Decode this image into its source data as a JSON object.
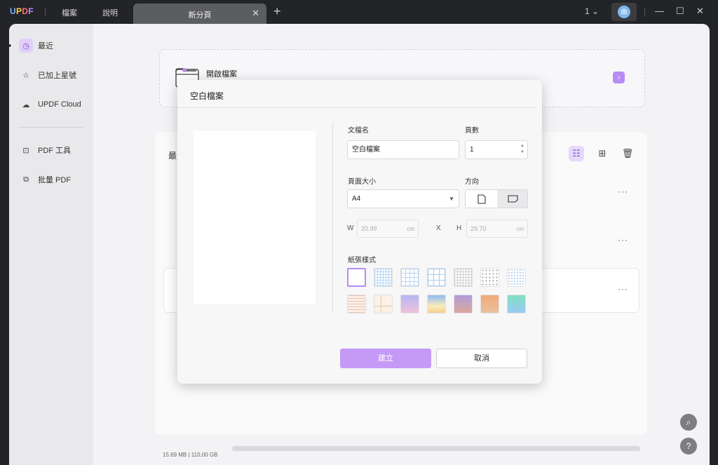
{
  "titlebar": {
    "logo": "UPDF",
    "menu": [
      "檔案",
      "說明"
    ],
    "tab_label": "新分頁",
    "account_number": "1",
    "avatar_initial": "曲"
  },
  "sidebar": {
    "items": [
      {
        "label": "最近",
        "icon": "clock-icon"
      },
      {
        "label": "已加上星號",
        "icon": "star-icon"
      },
      {
        "label": "UPDF Cloud",
        "icon": "cloud-icon"
      },
      {
        "label": "PDF 工具",
        "icon": "toolbox-icon"
      },
      {
        "label": "批量 PDF",
        "icon": "batch-icon"
      }
    ]
  },
  "main": {
    "open_file_label": "開啟檔案",
    "recent_label": "最",
    "storage_text": "15.69 MB | 110.00 GB",
    "storage_used_fraction": 0.0001
  },
  "dialog": {
    "title": "空白檔案",
    "doc_name_label": "文檔名",
    "doc_name_value": "空白檔案",
    "pages_label": "頁數",
    "pages_value": "1",
    "page_size_label": "頁面大小",
    "page_size_value": "A4",
    "orientation_label": "方向",
    "w_label": "W",
    "w_value": "20.99",
    "h_label": "H",
    "h_value": "29.70",
    "x_label": "X",
    "unit": "cm",
    "paper_style_label": "紙張樣式",
    "create_label": "建立",
    "cancel_label": "取消"
  },
  "colors": {
    "accent": "#b68cf3",
    "accent_light": "#e6d8fa",
    "titlebar_bg": "#232427"
  }
}
